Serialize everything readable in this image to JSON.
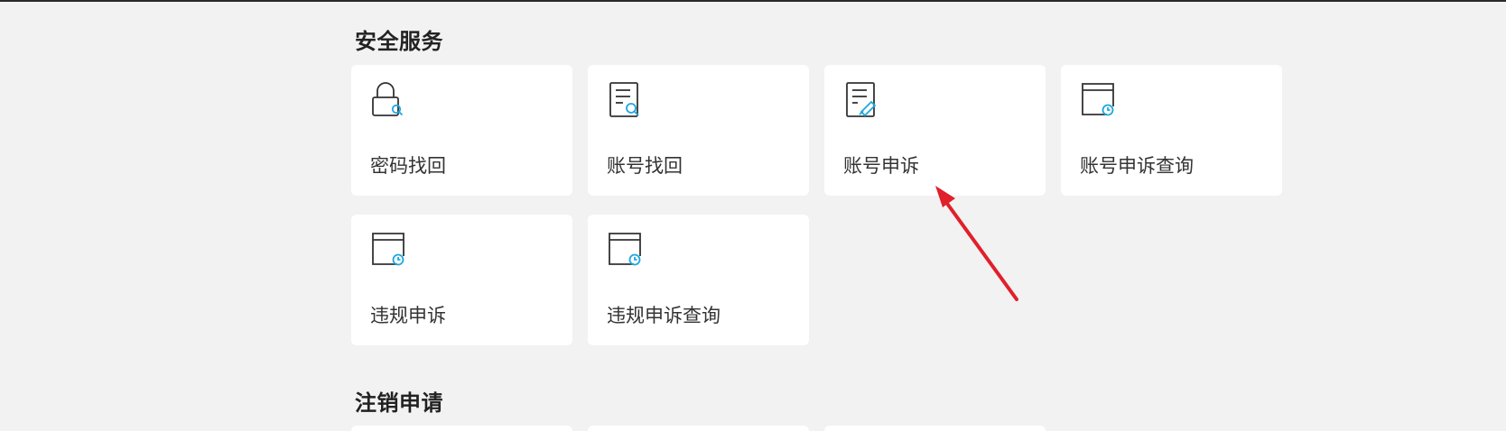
{
  "sections": [
    {
      "title": "安全服务",
      "items": [
        {
          "label": "密码找回",
          "icon": "lock-search-icon"
        },
        {
          "label": "账号找回",
          "icon": "document-search-icon"
        },
        {
          "label": "账号申诉",
          "icon": "document-edit-icon"
        },
        {
          "label": "账号申诉查询",
          "icon": "window-clock-icon"
        },
        {
          "label": "违规申诉",
          "icon": "window-clock-icon"
        },
        {
          "label": "违规申诉查询",
          "icon": "window-clock-icon"
        }
      ]
    },
    {
      "title": "注销申请",
      "items": []
    }
  ],
  "colors": {
    "background": "#f2f2f2",
    "card": "#ffffff",
    "icon_stroke": "#333333",
    "icon_accent": "#1ea7e0",
    "annotation_arrow": "#e0202a"
  }
}
